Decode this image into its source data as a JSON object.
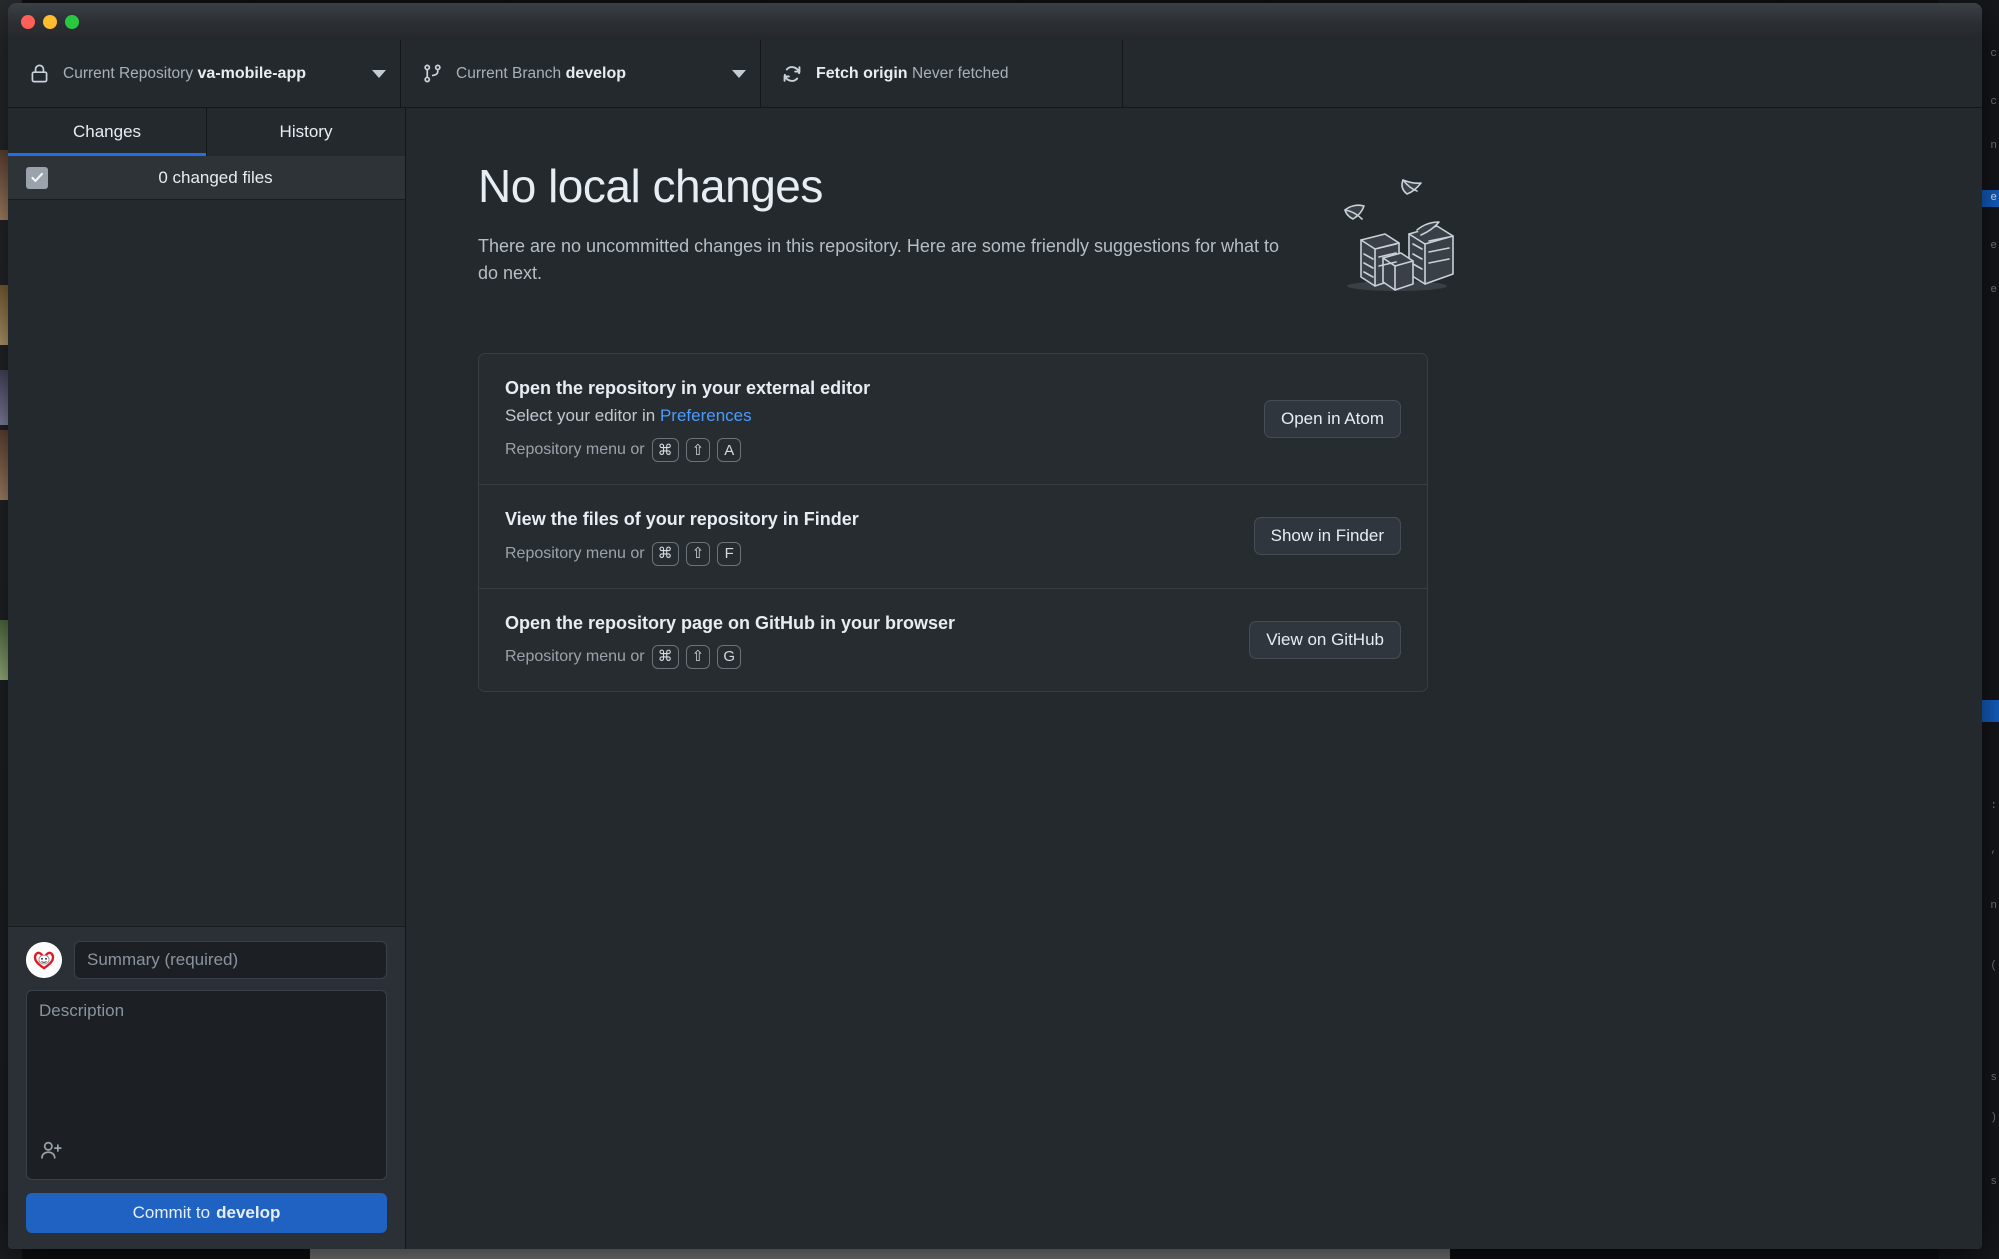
{
  "window": {
    "traffic_lights": [
      "close",
      "minimize",
      "zoom"
    ],
    "accent": "#1f6feb"
  },
  "toolbar": {
    "repository": {
      "label": "Current Repository",
      "value": "va-mobile-app",
      "icon": "lock-icon"
    },
    "branch": {
      "label": "Current Branch",
      "value": "develop",
      "icon": "git-branch-icon"
    },
    "fetch": {
      "label": "Fetch origin",
      "value": "Never fetched",
      "icon": "sync-icon"
    }
  },
  "sidebar": {
    "tabs": [
      {
        "label": "Changes",
        "active": true
      },
      {
        "label": "History",
        "active": false
      }
    ],
    "changed_files_label": "0 changed files",
    "changed_files_checked": true,
    "commit": {
      "summary_placeholder": "Summary (required)",
      "summary_value": "",
      "description_placeholder": "Description",
      "description_value": "",
      "coauthor_icon": "person-add-icon",
      "button_prefix": "Commit to",
      "button_branch": "develop"
    }
  },
  "main": {
    "title": "No local changes",
    "subtitle": "There are no uncommitted changes in this repository. Here are some friendly suggestions for what to do next.",
    "illustration": "papers-boxes-illustration",
    "suggestions": [
      {
        "title": "Open the repository in your external editor",
        "sub_prefix": "Select your editor in ",
        "sub_link": "Preferences",
        "keys_prefix": "Repository menu or",
        "keys": [
          "⌘",
          "⇧",
          "A"
        ],
        "button": "Open in Atom",
        "button_name": "open-in-atom-button"
      },
      {
        "title": "View the files of your repository in Finder",
        "sub_prefix": "",
        "sub_link": "",
        "keys_prefix": "Repository menu or",
        "keys": [
          "⌘",
          "⇧",
          "F"
        ],
        "button": "Show in Finder",
        "button_name": "show-in-finder-button"
      },
      {
        "title": "Open the repository page on GitHub in your browser",
        "sub_prefix": "",
        "sub_link": "",
        "keys_prefix": "Repository menu or",
        "keys": [
          "⌘",
          "⇧",
          "G"
        ],
        "button": "View on GitHub",
        "button_name": "view-on-github-button"
      }
    ]
  }
}
